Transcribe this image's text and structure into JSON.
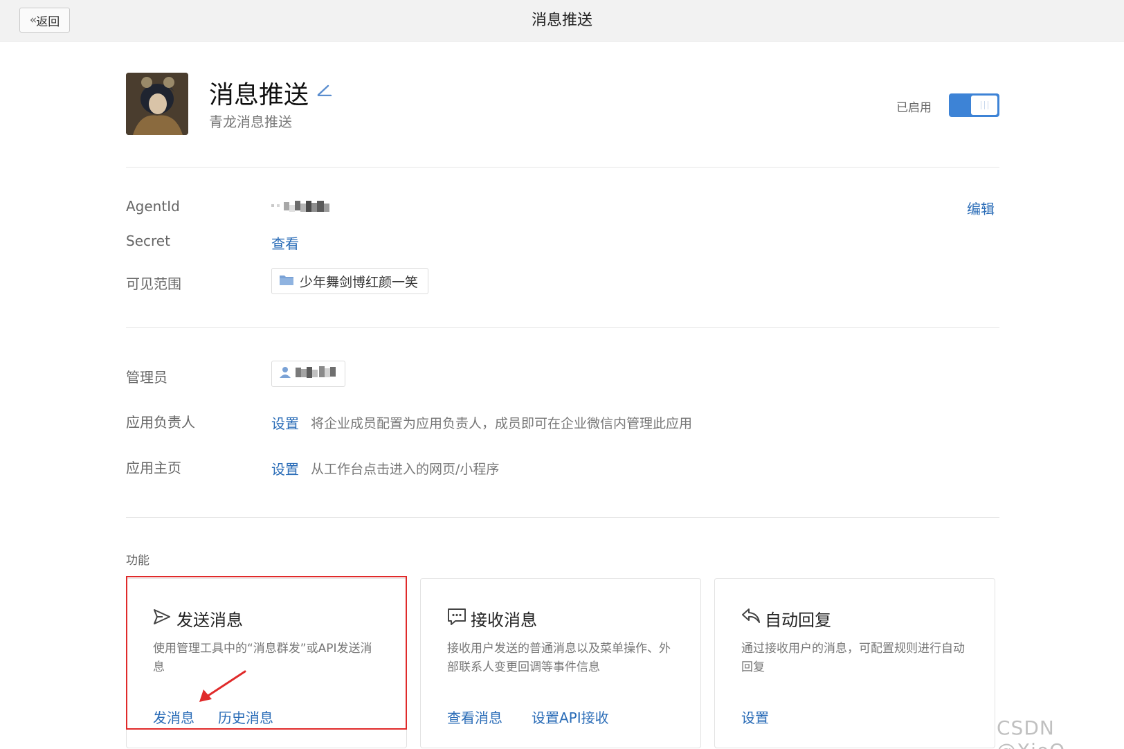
{
  "header": {
    "back_label": "返回",
    "title": "消息推送"
  },
  "app": {
    "name": "消息推送",
    "description": "青龙消息推送",
    "status_label": "已启用",
    "enabled": true
  },
  "details": {
    "agentid_label": "AgentId",
    "edit_label": "编辑",
    "secret_label": "Secret",
    "secret_link": "查看",
    "visibility_label": "可见范围",
    "visibility_value": "少年舞剑博红颜一笑"
  },
  "management": {
    "admin_label": "管理员",
    "owner_label": "应用负责人",
    "owner_link": "设置",
    "owner_hint": "将企业成员配置为应用负责人，成员即可在企业微信内管理此应用",
    "homepage_label": "应用主页",
    "homepage_link": "设置",
    "homepage_hint": "从工作台点击进入的网页/小程序"
  },
  "features": {
    "section_label": "功能",
    "cards": [
      {
        "title": "发送消息",
        "icon": "send-icon",
        "desc": "使用管理工具中的“消息群发”或API发送消息",
        "links": [
          "发消息",
          "历史消息"
        ]
      },
      {
        "title": "接收消息",
        "icon": "chat-bubble-icon",
        "desc": "接收用户发送的普通消息以及菜单操作、外部联系人变更回调等事件信息",
        "links": [
          "查看消息",
          "设置API接收"
        ]
      },
      {
        "title": "自动回复",
        "icon": "reply-icon",
        "desc": "通过接收用户的消息，可配置规则进行自动回复",
        "links": [
          "设置"
        ]
      }
    ]
  },
  "watermark": "CSDN @XioQ",
  "colors": {
    "link": "#2a6cb7",
    "toggle": "#3d83d6",
    "highlight": "#e02a2a"
  }
}
